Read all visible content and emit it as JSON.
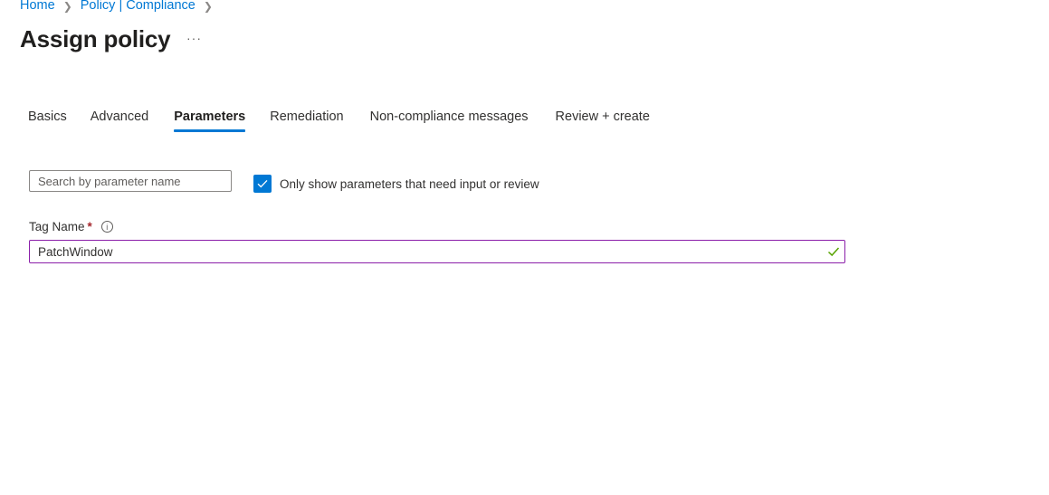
{
  "breadcrumb": [
    {
      "label": "Home"
    },
    {
      "label": "Policy | Compliance"
    }
  ],
  "page": {
    "title": "Assign policy",
    "more_label": "···"
  },
  "tabs": [
    {
      "label": "Basics",
      "active": false
    },
    {
      "label": "Advanced",
      "active": false
    },
    {
      "label": "Parameters",
      "active": true
    },
    {
      "label": "Remediation",
      "active": false
    },
    {
      "label": "Non-compliance messages",
      "active": false
    },
    {
      "label": "Review + create",
      "active": false
    }
  ],
  "filters": {
    "search_placeholder": "Search by parameter name",
    "search_value": "",
    "only_show_label": "Only show parameters that need input or review",
    "only_show_checked": true
  },
  "parameters": [
    {
      "label": "Tag Name",
      "required_marker": "*",
      "info_icon": "info-icon",
      "value": "PatchWindow",
      "valid": true
    }
  ],
  "colors": {
    "accent": "#0078d4",
    "field_focus_border": "#8b1fa9",
    "valid": "#57a300",
    "required": "#a4262c"
  }
}
